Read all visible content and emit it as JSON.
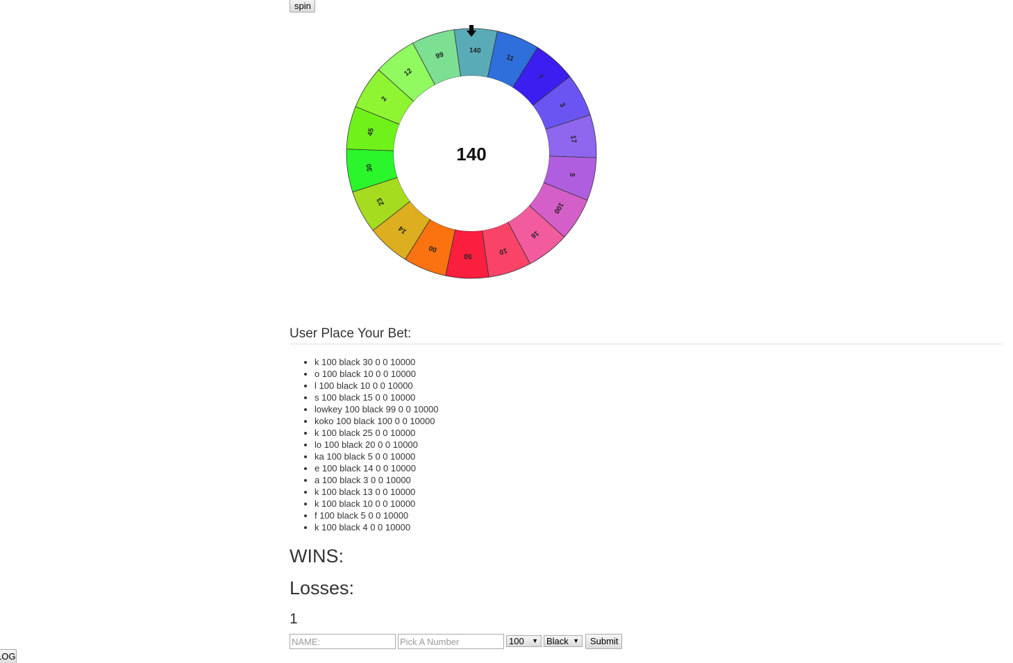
{
  "controls": {
    "spin_label": "spin",
    "login_label": "LOGIN"
  },
  "wheel": {
    "center_value": "140",
    "segments": [
      {
        "label": "140",
        "color": "#5aabb8"
      },
      {
        "label": "11",
        "color": "#2e6fdc"
      },
      {
        "label": "7",
        "color": "#3a1ff0"
      },
      {
        "label": "3",
        "color": "#6b55f2"
      },
      {
        "label": "17",
        "color": "#8f66ee"
      },
      {
        "label": "5",
        "color": "#b05ee0"
      },
      {
        "label": "100",
        "color": "#d55fc8"
      },
      {
        "label": "16",
        "color": "#f25c9e"
      },
      {
        "label": "10",
        "color": "#f94468"
      },
      {
        "label": "50",
        "color": "#fa1e3f"
      },
      {
        "label": "00",
        "color": "#fa7310"
      },
      {
        "label": "14",
        "color": "#dcae20"
      },
      {
        "label": "23",
        "color": "#a6dc20"
      },
      {
        "label": "30",
        "color": "#2bf52b"
      },
      {
        "label": "45",
        "color": "#6ff21a"
      },
      {
        "label": "2",
        "color": "#8ff532"
      },
      {
        "label": "12",
        "color": "#90fa60"
      },
      {
        "label": "99",
        "color": "#7ddf92"
      }
    ]
  },
  "bets": {
    "heading": "User Place Your Bet:",
    "items": [
      "k 100 black 30 0 0 10000",
      "o 100 black 10 0 0 10000",
      "l 100 black 10 0 0 10000",
      "s 100 black 15 0 0 10000",
      "lowkey 100 black 99 0 0 10000",
      "koko 100 black 100 0 0 10000",
      "k 100 black 25 0 0 10000",
      "lo 100 black 20 0 0 10000",
      "ka 100 black 5 0 0 10000",
      "e 100 black 14 0 0 10000",
      "a 100 black 3 0 0 10000",
      "k 100 black 13 0 0 10000",
      "k 100 black 10 0 0 10000",
      "f 100 black 5 0 0 10000",
      "k 100 black 4 0 0 10000"
    ]
  },
  "results": {
    "wins_label": "WINS:",
    "losses_label": "Losses:",
    "count": "1"
  },
  "form": {
    "name_placeholder": "NAME:",
    "number_placeholder": "Pick A Number",
    "amount_value": "100",
    "color_value": "Black",
    "submit_label": "Submit"
  },
  "icons": {
    "pointer": "arrow-down-icon",
    "dropdown": "caret-down-icon"
  }
}
